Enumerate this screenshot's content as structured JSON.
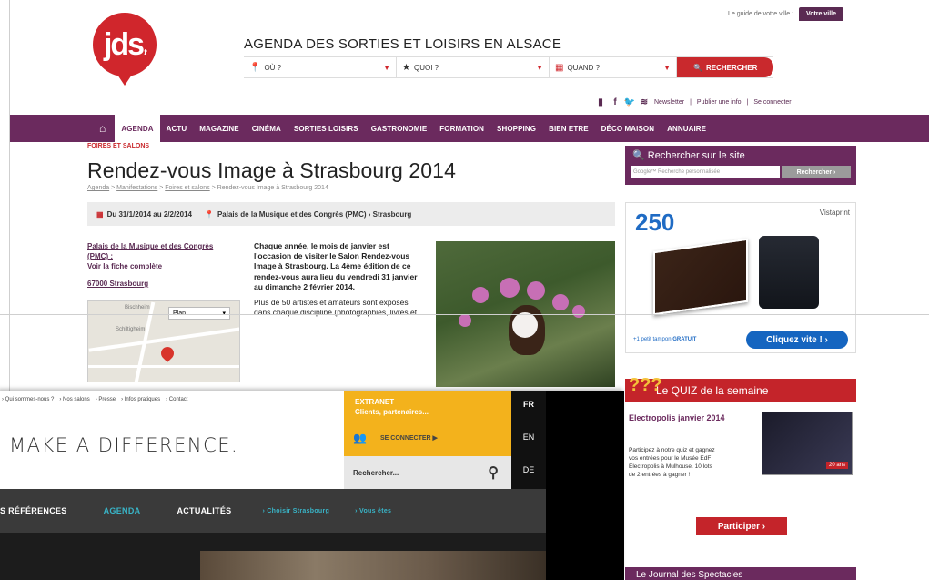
{
  "back": {
    "topline": {
      "guide": "Le guide de votre ville :",
      "ville": "Votre ville"
    },
    "logo": {
      "text": "jds",
      "tm": ".fr"
    },
    "headline": "AGENDA DES SORTIES ET LOISIRS EN ALSACE",
    "search": {
      "where": "OÙ ?",
      "what": "QUOI ?",
      "when": "QUAND ?",
      "button": "RECHERCHER"
    },
    "socials": {
      "newsletter": "Newsletter",
      "publier": "Publier une info",
      "connect": "Se connecter"
    },
    "nav": [
      "AGENDA",
      "ACTU",
      "MAGAZINE",
      "CINÉMA",
      "SORTIES LOISIRS",
      "GASTRONOMIE",
      "FORMATION",
      "SHOPPING",
      "BIEN ETRE",
      "DÉCO MAISON",
      "ANNUAIRE"
    ],
    "kicker": "FOIRES ET SALONS",
    "title": "Rendez-vous Image à Strasbourg 2014",
    "breadcrumb": {
      "a": "Agenda",
      "b": "Manifestations",
      "c": "Foires et salons",
      "d": "Rendez-vous Image à Strasbourg 2014"
    },
    "dates": "Du 31/1/2014 au 2/2/2014",
    "place": "Palais de la Musique et des Congrès (PMC) › Strasbourg",
    "venue": {
      "name": "Palais de la Musique et des Congrès (PMC) :",
      "link": "Voir la fiche complète",
      "city": "67000 Strasbourg"
    },
    "map": {
      "plan": "Plan",
      "l1": "Bischheim",
      "l2": "Schiltigheim"
    },
    "body": {
      "lead": "Chaque année, le mois de janvier est l'occasion de visiter le Salon Rendez-vous Image à Strasbourg. La 4ème édition de ce rendez-vous aura lieu du vendredi 31 janvier au dimanche 2 février 2014.",
      "p2": "Plus de 50 artistes et amateurs sont exposés dans chaque discipline (photographies, livres et"
    },
    "site_search": {
      "title": "Rechercher sur le site",
      "placeholder": "Google™ Recherche personnalisée",
      "button": "Rechercher ›"
    },
    "ad": {
      "number": "250",
      "brand": "Vistaprint",
      "promo": "+1 petit tampon",
      "gratuit": "GRATUIT",
      "cta": "Cliquez vite ! ›"
    },
    "quiz": {
      "head": "Le QUIZ de la semaine",
      "title": "Electropolis janvier 2014",
      "desc": "Participez à notre quiz et gagnez vos entrées pour le Musée EdF Electropolis à Mulhouse. 10 lots de 2 entrées à gagner !",
      "img_label": "20 ans",
      "button": "Participer ›"
    },
    "journal": "Le Journal des Spectacles"
  },
  "front": {
    "top_links": [
      "Qui sommes-nous ?",
      "Nos salons",
      "Presse",
      "Infos pratiques",
      "Contact"
    ],
    "tagline": "MAKE A DIFFERENCE.",
    "extranet": {
      "t1": "EXTRANET",
      "t2": "Clients, partenaires...",
      "connect": "SE CONNECTER ▶"
    },
    "search": "Rechercher...",
    "langs": [
      "FR",
      "EN",
      "DE"
    ],
    "nav": [
      "S RÉFÉRENCES",
      "AGENDA",
      "ACTUALITÉS",
      "› Choisir Strasbourg",
      "› Vous êtes"
    ]
  },
  "colors": {
    "jds_red": "#d0262c",
    "jds_purple": "#6b2a5e",
    "accent_yellow": "#f3b21c",
    "accent_cyan": "#39b5c8"
  }
}
